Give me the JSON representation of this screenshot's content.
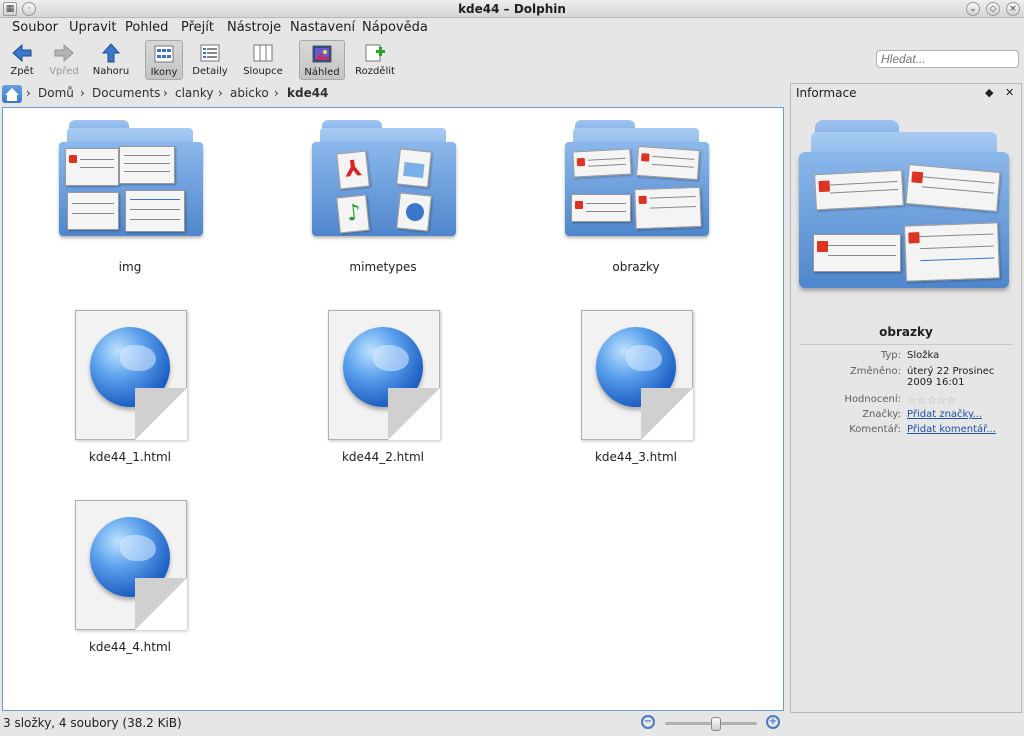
{
  "window": {
    "title": "kde44 – Dolphin"
  },
  "menu": [
    "Soubor",
    "Upravit",
    "Pohled",
    "Přejít",
    "Nástroje",
    "Nastavení",
    "Nápověda"
  ],
  "toolbar": {
    "back": "Zpět",
    "forward": "Vpřed",
    "up": "Nahoru",
    "icons": "Ikony",
    "details": "Detaily",
    "columns": "Sloupce",
    "preview": "Náhled",
    "split": "Rozdělit",
    "search_placeholder": "Hledat..."
  },
  "breadcrumb": [
    "Domů",
    "Documents",
    "clanky",
    "abicko",
    "kde44"
  ],
  "items": [
    {
      "name": "img",
      "type": "folder"
    },
    {
      "name": "mimetypes",
      "type": "folder"
    },
    {
      "name": "obrazky",
      "type": "folder"
    },
    {
      "name": "kde44_1.html",
      "type": "html"
    },
    {
      "name": "kde44_2.html",
      "type": "html"
    },
    {
      "name": "kde44_3.html",
      "type": "html"
    },
    {
      "name": "kde44_4.html",
      "type": "html"
    }
  ],
  "info": {
    "header": "Informace",
    "name": "obrazky",
    "type_label": "Typ:",
    "type_value": "Složka",
    "modified_label": "Změněno:",
    "modified_value": "úterý 22 Prosinec 2009 16:01",
    "rating_label": "Hodnocení:",
    "rating": 0,
    "tags_label": "Značky:",
    "tags_link": "Přidat značky...",
    "comment_label": "Komentář:",
    "comment_link": "Přidat komentář..."
  },
  "status": {
    "text": "3 složky, 4 soubory (38.2 KiB)",
    "zoom_level": 0.55
  }
}
